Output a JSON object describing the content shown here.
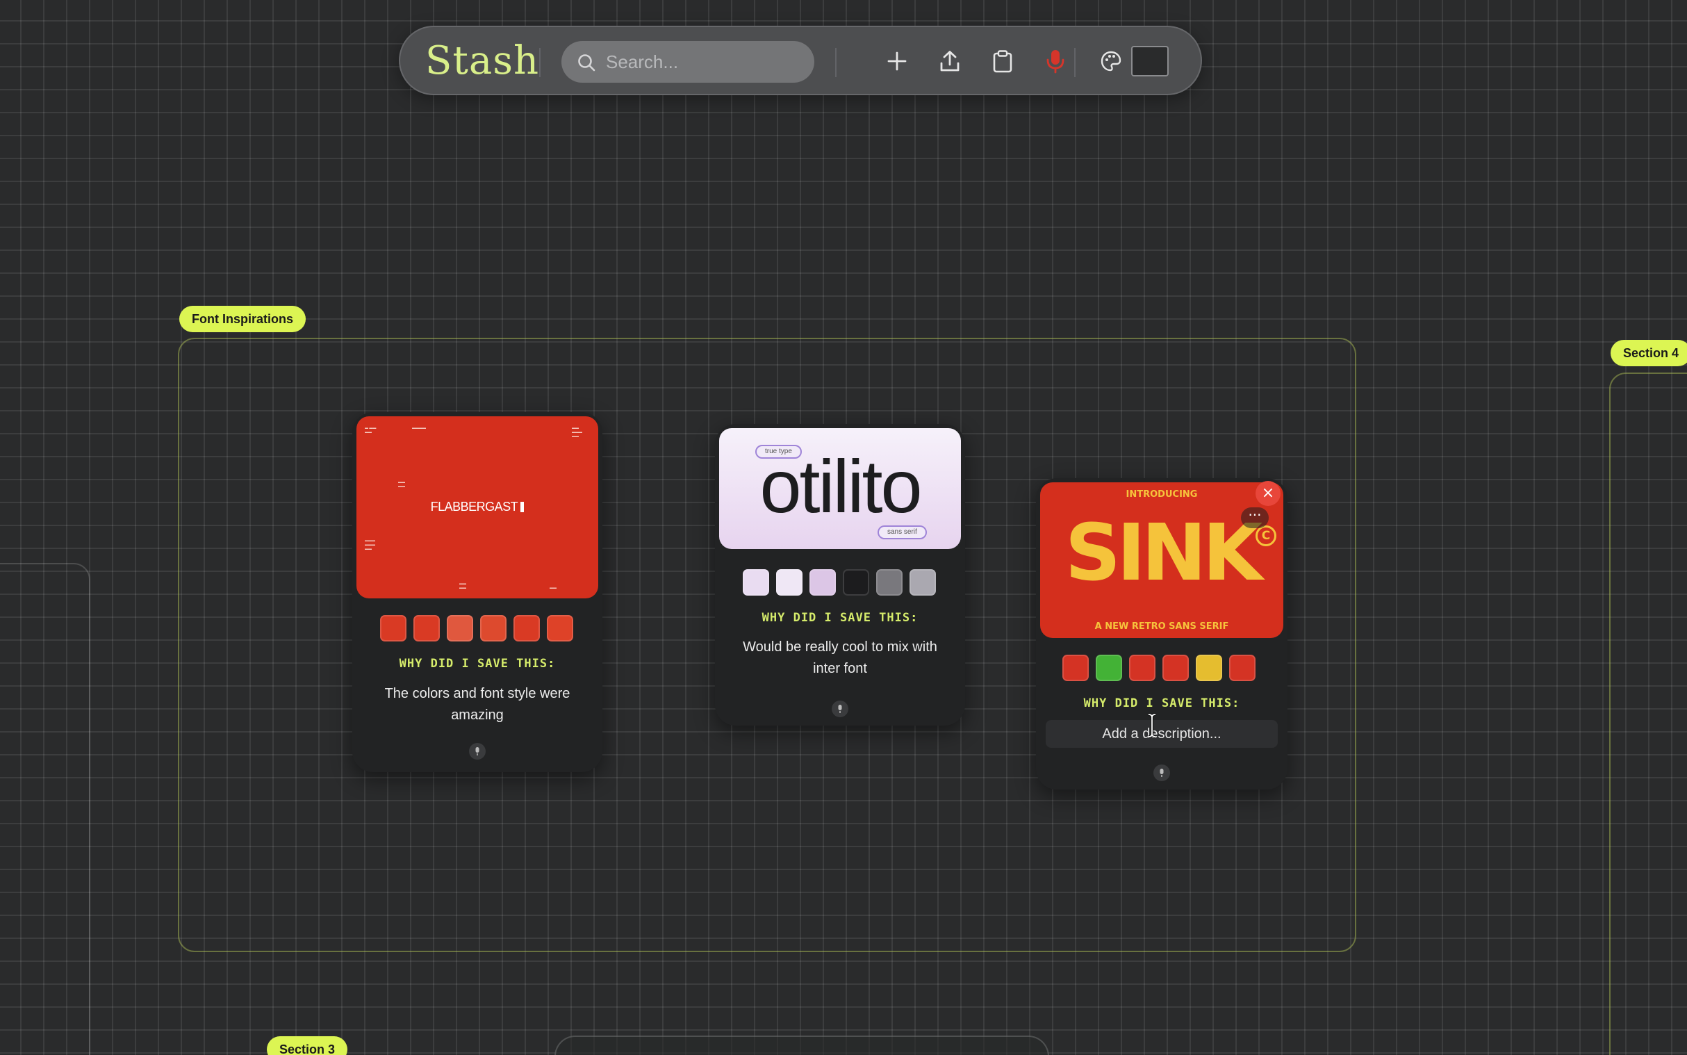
{
  "toolbar": {
    "logo": "Stash",
    "search_placeholder": "Search...",
    "icons": [
      "search-icon",
      "plus-icon",
      "upload-icon",
      "clipboard-icon",
      "microphone-icon",
      "palette-icon"
    ],
    "accent_color": "#d9ef8a",
    "mic_color": "#d6352a",
    "selected_color": "#2a2b2c"
  },
  "sections": {
    "font_inspirations": "Font Inspirations",
    "section4": "Section 4",
    "section3": "Section 3",
    "tag_color": "#dcf553"
  },
  "cards": [
    {
      "thumb_title": "FLABBERGAST",
      "palette": [
        "#d93a24",
        "#d93a24",
        "#e0583e",
        "#dd4a2e",
        "#d93a24",
        "#de4228"
      ],
      "prompt": "WHY DID I SAVE THIS:",
      "description": "The colors and font style were amazing"
    },
    {
      "thumb_word": "otilito",
      "pill_top": "true type",
      "pill_bottom": "sans serif",
      "palette": [
        "#e9dcf1",
        "#efe7f5",
        "#dcc6e6",
        "#1c1c1e",
        "#79787d",
        "#aaa8b0"
      ],
      "prompt": "WHY DID I SAVE THIS:",
      "description": "Would be really cool to mix with inter font"
    },
    {
      "thumb_intro": "INTRODUCING",
      "thumb_word": "SINK",
      "thumb_sub": "A NEW RETRO SANS SERIF",
      "thumb_mark": "C",
      "palette": [
        "#d43324",
        "#43b236",
        "#d43324",
        "#d43324",
        "#e5bd2f",
        "#d43324"
      ],
      "prompt": "WHY DID I SAVE THIS:",
      "description_placeholder": "Add a description...",
      "close_label": "×",
      "more_label": "···"
    }
  ]
}
